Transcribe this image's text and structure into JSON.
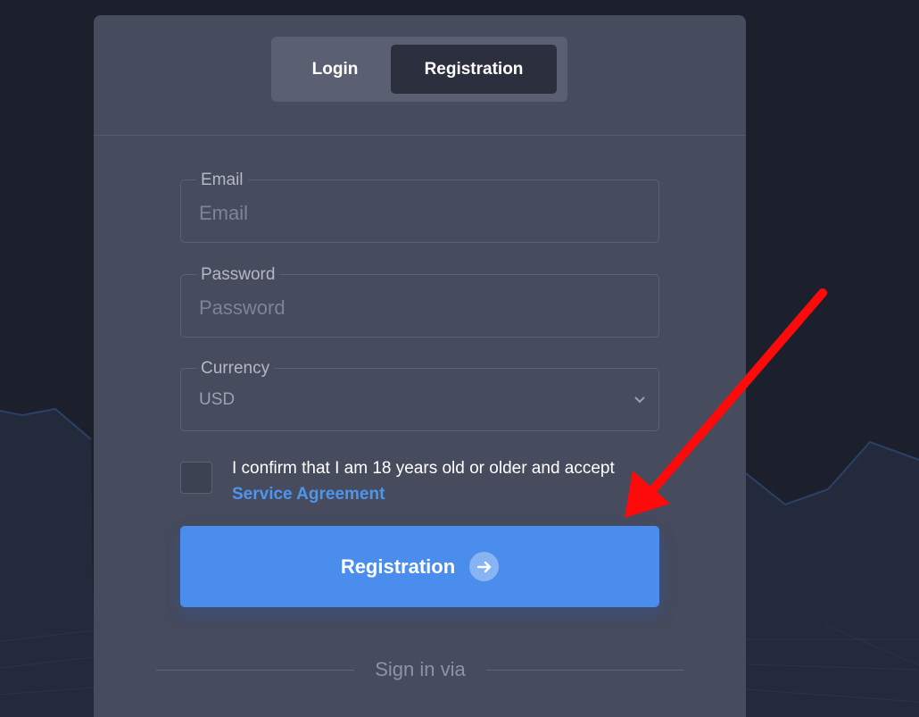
{
  "tabs": {
    "login_label": "Login",
    "registration_label": "Registration",
    "active": "registration"
  },
  "form": {
    "email": {
      "legend": "Email",
      "placeholder": "Email",
      "value": ""
    },
    "password": {
      "legend": "Password",
      "placeholder": "Password",
      "value": ""
    },
    "currency": {
      "legend": "Currency",
      "selected": "USD"
    },
    "consent": {
      "text": "I confirm that I am 18 years old or older and accept",
      "link_text": "Service Agreement",
      "checked": false
    },
    "submit_label": "Registration",
    "submit_icon": "arrow-right-icon"
  },
  "footer": {
    "sign_in_via": "Sign in via"
  },
  "annotation": {
    "icon": "red-arrow-icon",
    "color": "#ff0a0a"
  },
  "colors": {
    "background": "#1c1f2c",
    "card": "#464b5d",
    "accent": "#4b8ded",
    "link": "#4e95ef"
  }
}
